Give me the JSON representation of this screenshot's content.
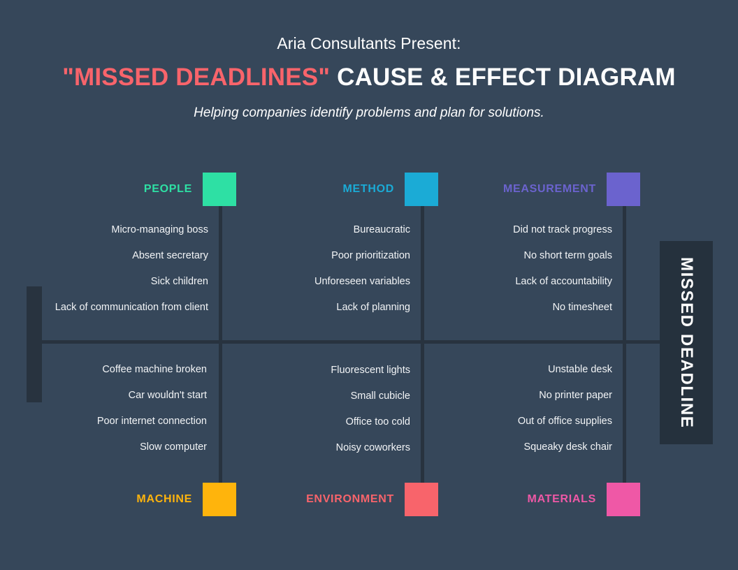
{
  "header": {
    "presenter": "Aria Consultants Present:",
    "title_accent": "\"MISSED DEADLINES\"",
    "title_rest": "CAUSE & EFFECT DIAGRAM",
    "subtitle": "Helping companies identify problems and plan for solutions."
  },
  "effect": {
    "label": "MISSED DEADLINE"
  },
  "colors": {
    "background": "#36475a",
    "spine": "#28333f",
    "effect_box": "#25313d",
    "title_accent": "#f8646b",
    "people": "#2ee0a4",
    "method": "#1babd6",
    "measurement": "#6b63ce",
    "machine": "#ffb40c",
    "environment": "#f8646b",
    "materials": "#ef58a6"
  },
  "categories": {
    "people": {
      "label": "PEOPLE",
      "color": "#2ee0a4",
      "causes": [
        "Micro-managing boss",
        "Absent secretary",
        "Sick children",
        "Lack of communication from client"
      ]
    },
    "method": {
      "label": "METHOD",
      "color": "#1babd6",
      "causes": [
        "Bureaucratic",
        "Poor prioritization",
        "Unforeseen variables",
        "Lack of planning"
      ]
    },
    "measurement": {
      "label": "MEASUREMENT",
      "color": "#6b63ce",
      "causes": [
        "Did not track progress",
        "No short term goals",
        "Lack of accountability",
        "No timesheet"
      ]
    },
    "machine": {
      "label": "MACHINE",
      "color": "#ffb40c",
      "causes": [
        "Coffee machine broken",
        "Car wouldn't start",
        "Poor internet connection",
        "Slow computer"
      ]
    },
    "environment": {
      "label": "ENVIRONMENT",
      "color": "#f8646b",
      "causes": [
        "Fluorescent lights",
        "Small cubicle",
        "Office too cold",
        "Noisy coworkers"
      ]
    },
    "materials": {
      "label": "MATERIALS",
      "color": "#ef58a6",
      "causes": [
        "Unstable desk",
        "No printer paper",
        "Out of office supplies",
        "Squeaky desk chair"
      ]
    }
  }
}
